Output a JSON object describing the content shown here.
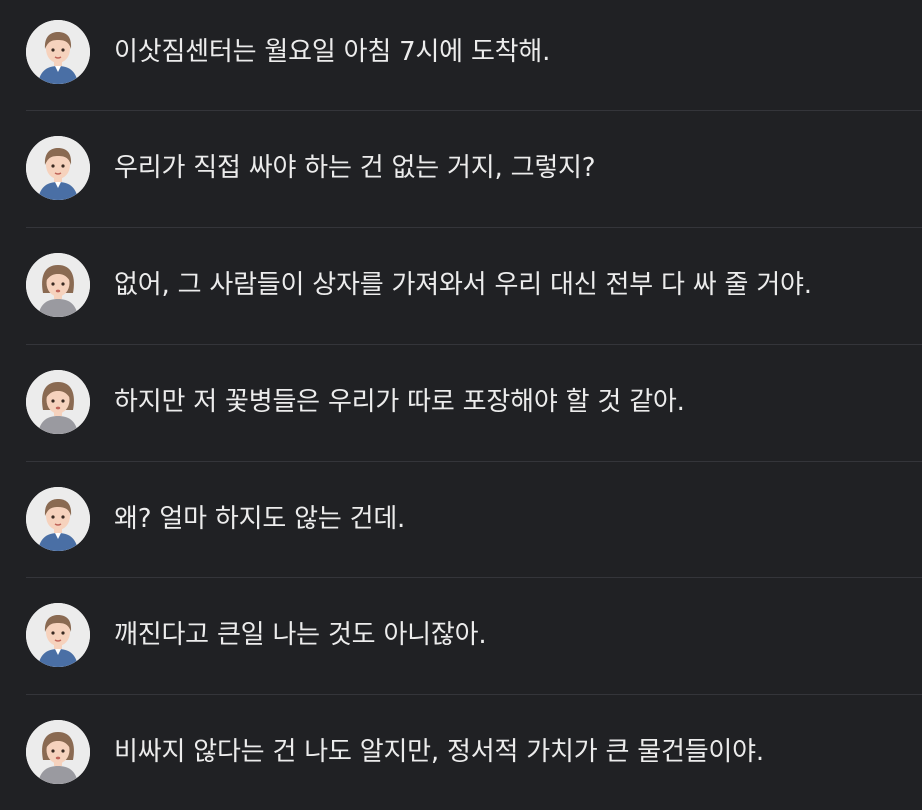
{
  "messages": [
    {
      "speaker": "man",
      "text": "이삿짐센터는 월요일 아침 7시에 도착해."
    },
    {
      "speaker": "man",
      "text": "우리가 직접 싸야 하는 건 없는 거지, 그렇지?"
    },
    {
      "speaker": "woman",
      "text": "없어, 그 사람들이 상자를 가져와서 우리 대신 전부 다 싸 줄 거야."
    },
    {
      "speaker": "woman",
      "text": "하지만 저 꽃병들은 우리가 따로 포장해야 할 것 같아."
    },
    {
      "speaker": "man",
      "text": "왜? 얼마 하지도 않는 건데."
    },
    {
      "speaker": "man",
      "text": "깨진다고 큰일 나는 것도 아니잖아."
    },
    {
      "speaker": "woman",
      "text": "비싸지 않다는 건 나도 알지만, 정서적 가치가 큰 물건들이야."
    }
  ],
  "colors": {
    "background": "#202124",
    "divider": "#34353a",
    "text": "#ececec",
    "avatar_bg": "#ececec",
    "hair": "#8a6a52",
    "skin": "#f6d2bd",
    "man_shirt": "#4a6fa5",
    "woman_shirt": "#9a9aa0"
  }
}
